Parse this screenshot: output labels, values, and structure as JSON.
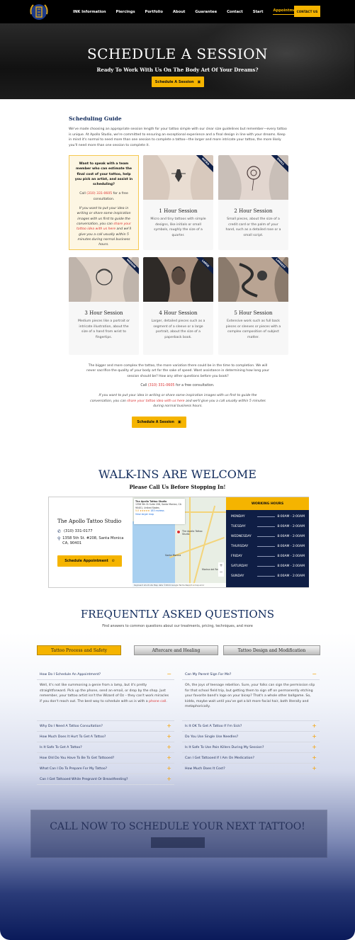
{
  "nav": {
    "items": [
      "INK Information",
      "Piercings",
      "Portfolio",
      "About",
      "Guarantee",
      "Contact",
      "Start",
      "Appointments"
    ],
    "contact_button": "CONTACT US"
  },
  "hero": {
    "title": "SCHEDULE A SESSION",
    "subtitle": "Ready To Work With Us On The Body Art Of Your Dreams?",
    "button": "Schedule A Session"
  },
  "guide": {
    "title": "Scheduling Guide",
    "intro": "We've made choosing an appropriate session length for your tattoo simple with our clear size guidelines but remember—every tattoo is unique. At Apollo Studio, we're committed to ensuring an exceptional experience and a final design in line with your dreams. Keep in mind it's normal to need more than one session to complete a tattoo—the larger and more intricate your tattoo, the more likely you'll need more than one session to complete it.",
    "call_box": {
      "heading": "Want to speak with a team member who can estimate the final cost of your tattoo, help you pick an artist, and assist in scheduling?",
      "call_prefix": "Call ",
      "phone": "(310) 331-0605",
      "call_suffix": " for a free consultation.",
      "italic_1": "If you want to put your idea in writing or share some inspiration images with us first to guide the conversation, you can ",
      "link": "share your tattoo idea with us here",
      "italic_2": " and we'll give you a call usually within 5 minutes during normal business hours."
    },
    "sessions": [
      {
        "tag": "MICRO",
        "title": "1 Hour Session",
        "desc": "Micro and tiny tattoos with simple designs, like initials or small symbols, roughly the size of a quarter."
      },
      {
        "tag": "SMALL",
        "title": "2 Hour Session",
        "desc": "Small pieces, about the size of a credit card or the palm of your hand, such as a detailed rose or a small script."
      },
      {
        "tag": "MEDIUM",
        "title": "3 Hour Session",
        "desc": "Medium pieces like a portrait or intricate illustration, about the size of a hand from wrist to fingertips."
      },
      {
        "tag": "LARGE",
        "title": "4 Hour Session",
        "desc": "Larger, detailed pieces such as a segment of a sleeve or a large portrait, about the size of a paperback book."
      },
      {
        "tag": "LARGEST",
        "title": "5 Hour Session",
        "desc": "Extensive work such as full back pieces or sleeves or pieces with a complex composition of subject matter."
      }
    ],
    "note": "The bigger and more complex the tattoo, the more variation there could be in the time to completion. We will never sacrifice the quality of your body art for the sake of speed. Want assistance in determining how long your session should be? How any other questions before you book?",
    "note_call_prefix": "Call ",
    "note_phone": "(310) 331-0605",
    "note_call_suffix": " for a free consultation.",
    "note_italic_1": "If you want to put your idea in writing or share some inspiration images with us first to guide the conversation, you can ",
    "note_link": "share your tattoo idea with us here",
    "note_italic_2": " and we'll give you a call usually within 5 minutes during normal business hours.",
    "button": "Schedule A Session"
  },
  "walkins": {
    "title": "WALK-INS ARE WELCOME",
    "subtitle": "Please Call Us Before Stopping In!",
    "studio_name": "The Apollo Tattoo Studio",
    "phone": "(310) 331-0177",
    "address": "1358 5th St. #208, Santa Monica CA, 90401",
    "button": "Schedule Appointment",
    "map": {
      "info_title": "The Apollo Tattoo Studio",
      "info_address": "1358 5th St Suite 208, Santa Monica, CA 90401, United States",
      "info_rating": "5.0 ★★★★★",
      "info_reviews": "183 reviews",
      "info_link": "View larger map",
      "pin_label": "The Apollo Tattoo Studio",
      "labels": [
        "Santa Monica",
        "Marina del Rey"
      ],
      "footer": "Keyboard shortcuts  Map data ©2024 Google  Terms  Report a map error"
    },
    "hours_title": "WORKING HOURS",
    "hours": [
      {
        "day": "MONDAY",
        "time": "8:00AM - 2:00AM"
      },
      {
        "day": "TUESDAY",
        "time": "8:00AM - 2:00AM"
      },
      {
        "day": "WEDNESDAY",
        "time": "8:00AM - 2:00AM"
      },
      {
        "day": "THURSDAY",
        "time": "8:00AM - 2:00AM"
      },
      {
        "day": "FRIDAY",
        "time": "8:00AM - 2:00AM"
      },
      {
        "day": "SATURDAY",
        "time": "8:00AM - 2:00AM"
      },
      {
        "day": "SUNDAY",
        "time": "8:00AM - 2:00AM"
      }
    ]
  },
  "faq": {
    "title": "FREQUENTLY ASKED QUESTIONS",
    "subtitle": "Find answers to common questions about our treatments, pricing, techniques, and more",
    "tabs": [
      "Tattoo Process and Safety",
      "Aftercare and Healing",
      "Tattoo Design and Modification"
    ],
    "left": {
      "open_question": "How Do I Schedule An Appointment?",
      "open_answer": "Well, it's not like summoning a genie from a lamp, but it's pretty straightforward. Pick up the phone, send an email, or drop by the shop. Just remember, your tattoo artist isn't the Wizard of Oz – they can't work miracles if you don't reach out. The best way to schedule with us is with a ",
      "open_link": "phone call",
      "open_end": ".",
      "questions": [
        "Why Do I Need A Tattoo Consultation?",
        "How Much Does It Hurt To Get A Tattoo?",
        "Is It Safe To Get A Tattoo?",
        "How Old Do You Have To Be To Get Tattooed?",
        "What Can I Do To Prepare For My Tattoo?",
        "Can I Get Tattooed While Pregnant Or Breastfeeding?"
      ]
    },
    "right": {
      "open_question": "Can My Parent Sign For Me?",
      "open_answer": "Oh, the joys of teenage rebellion. Sure, your folks can sign the permission slip for that school field trip, but getting them to sign off on permanently etching your favorite band's logo on your bicep? That's a whole other ballgame. So, kiddo, maybe wait until you've got a bit more facial hair, both literally and metaphorically.",
      "questions": [
        "Is It OK To Get A Tattoo If I'm Sick?",
        "Do You Use Single Use Needles?",
        "Is It Safe To Use Pain Killers During My Session?",
        "Can I Get Tattooed If I Am On Medication?",
        "How Much Does It Cost?"
      ]
    }
  },
  "cta": {
    "title": "CALL NOW TO SCHEDULE YOUR NEXT TATTOO!"
  },
  "colors": {
    "accent": "#f5b400",
    "navy": "#102a5b",
    "link": "#d93030"
  }
}
